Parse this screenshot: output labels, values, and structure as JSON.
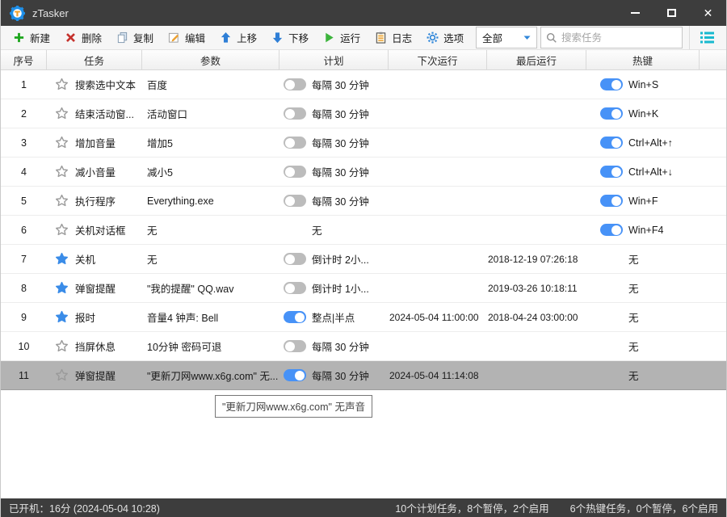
{
  "window": {
    "title": "zTasker"
  },
  "colors": {
    "titlebar_bg": "#3d3d3d",
    "statusbar_bg": "#3d3d3d",
    "selected_row_bg": "#b3b3b3",
    "toggle_on": "#4792f7",
    "toggle_off": "#bcbcbc",
    "star_filled": "#3a8ce8",
    "star_outline": "#9a9a9a",
    "accent_blue": "#2f86d9",
    "green": "#1ca51c",
    "red": "#c5312c",
    "orange": "#eda233",
    "teal": "#17b9cf"
  },
  "toolbar": {
    "buttons": [
      {
        "icon": "plus-icon",
        "label": "新建"
      },
      {
        "icon": "delete-x-icon",
        "label": "删除"
      },
      {
        "icon": "copy-icon",
        "label": "复制"
      },
      {
        "icon": "edit-icon",
        "label": "编辑"
      },
      {
        "icon": "arrow-up-icon",
        "label": "上移"
      },
      {
        "icon": "arrow-down-icon",
        "label": "下移"
      },
      {
        "icon": "play-icon",
        "label": "运行"
      },
      {
        "icon": "log-icon",
        "label": "日志"
      },
      {
        "icon": "gear-icon",
        "label": "选项"
      }
    ],
    "filter_value": "全部",
    "search_placeholder": "搜索任务"
  },
  "table": {
    "columns": [
      {
        "key": "num",
        "label": "序号"
      },
      {
        "key": "task",
        "label": "任务"
      },
      {
        "key": "params",
        "label": "参数"
      },
      {
        "key": "plan",
        "label": "计划"
      },
      {
        "key": "next",
        "label": "下次运行"
      },
      {
        "key": "last",
        "label": "最后运行"
      },
      {
        "key": "hotkey",
        "label": "热键"
      },
      {
        "key": "filler",
        "label": ""
      }
    ],
    "rows": [
      {
        "num": "1",
        "starred": false,
        "task": "搜索选中文本",
        "params": "百度",
        "plan_toggle": "off",
        "plan": "每隔 30 分钟",
        "next": "",
        "last": "",
        "hotkey_toggle": "on",
        "hotkey": "Win+S",
        "selected": false
      },
      {
        "num": "2",
        "starred": false,
        "task": "结束活动窗...",
        "params": "活动窗口",
        "plan_toggle": "off",
        "plan": "每隔 30 分钟",
        "next": "",
        "last": "",
        "hotkey_toggle": "on",
        "hotkey": "Win+K",
        "selected": false
      },
      {
        "num": "3",
        "starred": false,
        "task": "增加音量",
        "params": "增加5",
        "plan_toggle": "off",
        "plan": "每隔 30 分钟",
        "next": "",
        "last": "",
        "hotkey_toggle": "on",
        "hotkey": "Ctrl+Alt+↑",
        "selected": false
      },
      {
        "num": "4",
        "starred": false,
        "task": "减小音量",
        "params": "减小5",
        "plan_toggle": "off",
        "plan": "每隔 30 分钟",
        "next": "",
        "last": "",
        "hotkey_toggle": "on",
        "hotkey": "Ctrl+Alt+↓",
        "selected": false
      },
      {
        "num": "5",
        "starred": false,
        "task": "执行程序",
        "params": "Everything.exe",
        "plan_toggle": "off",
        "plan": "每隔 30 分钟",
        "next": "",
        "last": "",
        "hotkey_toggle": "on",
        "hotkey": "Win+F",
        "selected": false
      },
      {
        "num": "6",
        "starred": false,
        "task": "关机对话框",
        "params": "无",
        "plan_toggle": "none",
        "plan": "无",
        "next": "",
        "last": "",
        "hotkey_toggle": "on",
        "hotkey": "Win+F4",
        "selected": false
      },
      {
        "num": "7",
        "starred": true,
        "task": "关机",
        "params": "无",
        "plan_toggle": "off",
        "plan": "倒计时 2小...",
        "next": "",
        "last": "2018-12-19 07:26:18",
        "hotkey_toggle": "none",
        "hotkey": "无",
        "selected": false
      },
      {
        "num": "8",
        "starred": true,
        "task": "弹窗提醒",
        "params": "\"我的提醒\" QQ.wav",
        "plan_toggle": "off",
        "plan": "倒计时 1小...",
        "next": "",
        "last": "2019-03-26 10:18:11",
        "hotkey_toggle": "none",
        "hotkey": "无",
        "selected": false
      },
      {
        "num": "9",
        "starred": true,
        "task": "报时",
        "params": "音量4 钟声: Bell",
        "plan_toggle": "on",
        "plan": "整点|半点",
        "next": "2024-05-04 11:00:00",
        "last": "2018-04-24 03:00:00",
        "hotkey_toggle": "none",
        "hotkey": "无",
        "selected": false
      },
      {
        "num": "10",
        "starred": false,
        "task": "挡屏休息",
        "params": "10分钟 密码可退",
        "plan_toggle": "off",
        "plan": "每隔 30 分钟",
        "next": "",
        "last": "",
        "hotkey_toggle": "none",
        "hotkey": "无",
        "selected": false
      },
      {
        "num": "11",
        "starred": false,
        "task": "弹窗提醒",
        "params": "\"更新刀网www.x6g.com\" 无...",
        "plan_toggle": "on",
        "plan": "每隔 30 分钟",
        "next": "2024-05-04 11:14:08",
        "last": "",
        "hotkey_toggle": "none",
        "hotkey": "无",
        "selected": true
      }
    ]
  },
  "tooltip": {
    "text": "\"更新刀网www.x6g.com\" 无声音"
  },
  "statusbar": {
    "left": "已开机：16分 (2024-05-04 10:28)",
    "right_plan": "10个计划任务，8个暂停，2个启用",
    "right_hotkey": "6个热键任务，0个暂停，6个启用"
  }
}
